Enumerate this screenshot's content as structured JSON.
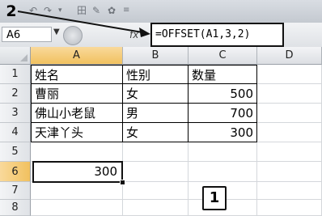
{
  "formula_bar": {
    "name_box": "A6",
    "formula": "=OFFSET(A1,3,2)"
  },
  "annotations": {
    "step1": "1",
    "step2": "2"
  },
  "columns": [
    "A",
    "B",
    "C",
    "D"
  ],
  "rows": [
    "1",
    "2",
    "3",
    "4",
    "5",
    "6",
    "7",
    "8"
  ],
  "cells": {
    "r1": {
      "a": "姓名",
      "b": "性别",
      "c": "数量"
    },
    "r2": {
      "a": "曹丽",
      "b": "女",
      "c": "500"
    },
    "r3": {
      "a": "佛山小老鼠",
      "b": "男",
      "c": "700"
    },
    "r4": {
      "a": "天津丫头",
      "b": "女",
      "c": "300"
    },
    "r6": {
      "a": "300"
    }
  },
  "colors": {
    "selected_header": "#f1c15f",
    "annotation": "#111111"
  }
}
